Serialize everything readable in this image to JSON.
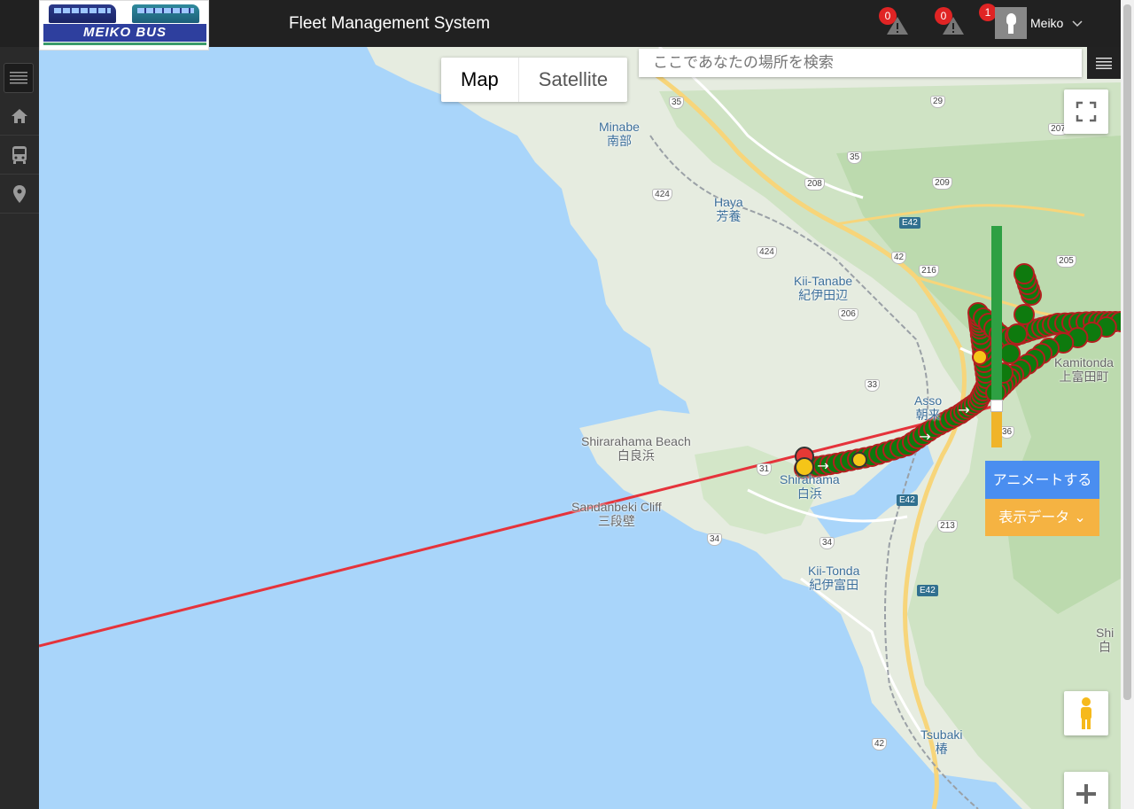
{
  "header": {
    "brand": "MEIKO BUS",
    "title": "Fleet Management System",
    "alerts": [
      {
        "count": "0",
        "icon": "warning-icon"
      },
      {
        "count": "0",
        "icon": "warning-icon"
      }
    ],
    "notifications_count": "1",
    "user_name": "Meiko"
  },
  "sidebar": {
    "items": [
      {
        "icon": "menu-icon"
      },
      {
        "icon": "home-icon"
      },
      {
        "icon": "bus-icon"
      },
      {
        "icon": "location-pin-icon"
      }
    ]
  },
  "map": {
    "type_buttons": [
      "Map",
      "Satellite"
    ],
    "active_type": "Map",
    "search_placeholder": "ここであなたの場所を検索",
    "animate_button": "アニメートする",
    "display_data_button": "表示データ",
    "timeline_progress": 0.84,
    "labels": {
      "minabe": "Minabe",
      "minabe_jp": "南部",
      "haya": "Haya",
      "haya_jp": "芳養",
      "kii_tanabe": "Kii-Tanabe",
      "kii_tanabe_jp": "紀伊田辺",
      "kamitonda": "Kamitonda",
      "kamitonda_jp": "上富田町",
      "asso": "Asso",
      "asso_jp": "朝来",
      "shirarahama": "Shirarahama Beach",
      "shirarahama_jp": "白良浜",
      "shirahama": "Shirahama",
      "shirahama_jp": "白浜",
      "sandanbeki": "Sandanbeki Cliff",
      "sandanbeki_jp": "三段壁",
      "kii_tonda": "Kii-Tonda",
      "kii_tonda_jp": "紀伊富田",
      "tsubaki": "Tsubaki",
      "tsubaki_jp": "椿",
      "shi": "Shi",
      "shi_jp": "白"
    },
    "road_numbers": [
      "35",
      "29",
      "208",
      "35",
      "209",
      "424",
      "E42",
      "424",
      "42",
      "216",
      "206",
      "205",
      "33",
      "36",
      "31",
      "E42",
      "213",
      "34",
      "34",
      "E42",
      "42",
      "207"
    ],
    "colors": {
      "route_line": "#e5333b",
      "track_point": "#0e7a0e",
      "track_point_border": "#b31f1f",
      "start_point": "#e53935",
      "stop_point": "#f5c518",
      "animate_button": "#4a8ef0",
      "display_data_button": "#f5b342"
    }
  }
}
